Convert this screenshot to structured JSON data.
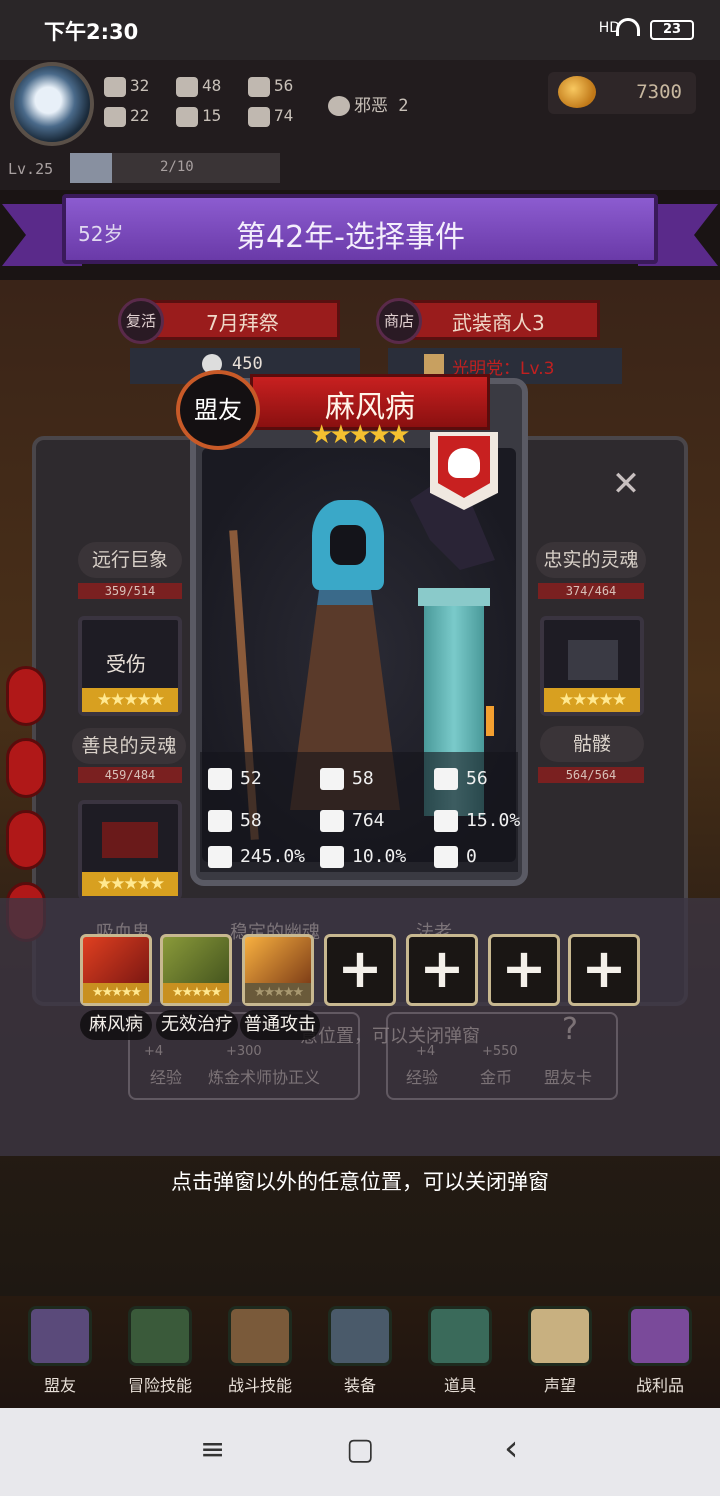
{
  "status_bar": {
    "time": "下午2:30",
    "signal": "HD",
    "battery": "23"
  },
  "player": {
    "stats": [
      {
        "icon": "fist-icon",
        "value": "32"
      },
      {
        "icon": "clover-icon",
        "value": "22"
      },
      {
        "icon": "boot-icon",
        "value": "48"
      },
      {
        "icon": "armor-icon",
        "value": "15"
      },
      {
        "icon": "wizard-hat-icon",
        "value": "56"
      },
      {
        "icon": "leaf-icon",
        "value": "74"
      }
    ],
    "alignment": "邪恶 2",
    "coins": "7300",
    "level": "Lv.25",
    "xp_text": "2/10",
    "xp_progress": 0.2
  },
  "banner": {
    "age": "52岁",
    "title": "第42年-选择事件"
  },
  "events": [
    {
      "tag": "复活",
      "name": "7月拜祭",
      "cost": "450"
    },
    {
      "tag": "商店",
      "name": "武装商人3",
      "extra": "光明党：Lv.3"
    }
  ],
  "side_left": [
    {
      "name": "远行巨象",
      "hp": "359/514"
    },
    {
      "name": "善良的灵魂",
      "hp": "459/484",
      "card_label": "受伤"
    },
    {
      "name": "吸血鬼"
    }
  ],
  "side_right": [
    {
      "name": "忠实的灵魂",
      "hp": "374/464"
    },
    {
      "name": "骷髅",
      "hp": "564/564"
    },
    {
      "name": "法老"
    }
  ],
  "middle_ghost": "稳定的幽魂",
  "card": {
    "badge": "盟友",
    "name": "麻风病",
    "stars": "★★★★★",
    "stats": [
      {
        "icon": "sword-icon",
        "value": "52"
      },
      {
        "icon": "shield-icon",
        "value": "58"
      },
      {
        "icon": "hook-icon",
        "value": "56"
      },
      {
        "icon": "hood-icon",
        "value": "58"
      },
      {
        "icon": "heart-icon",
        "value": "764"
      },
      {
        "icon": "flame-icon",
        "value": "15.0%"
      },
      {
        "icon": "burst-icon",
        "value": "245.0%"
      },
      {
        "icon": "tornado-icon",
        "value": "10.0%"
      },
      {
        "icon": "boot-icon",
        "value": "0"
      }
    ]
  },
  "skills": [
    {
      "name": "麻风病",
      "stars": "★★★★★",
      "color": "#c83020"
    },
    {
      "name": "无效治疗",
      "stars": "★★★★★",
      "color": "#6a7a2a"
    },
    {
      "name": "普通攻击",
      "stars": "★★★★★",
      "color": "#c87020"
    }
  ],
  "add_slot": "+",
  "rewards_ghost": [
    {
      "amount": "+4",
      "label": "经验"
    },
    {
      "amount": "+300",
      "label": "炼金术师协正义"
    },
    {
      "amount": "+4",
      "label": "经验"
    },
    {
      "amount": "+550",
      "label": "金币"
    },
    {
      "amount": "?",
      "label": "盟友卡"
    }
  ],
  "ghost_hint": "意位置，可以关闭弹窗",
  "hint": "点击弹窗以外的任意位置，可以关闭弹窗",
  "nav": [
    {
      "label": "盟友",
      "icon": "gloves-icon"
    },
    {
      "label": "冒险技能",
      "icon": "spellbook-icon"
    },
    {
      "label": "战斗技能",
      "icon": "backpack-icon"
    },
    {
      "label": "装备",
      "icon": "crossed-swords-icon"
    },
    {
      "label": "道具",
      "icon": "satchel-icon"
    },
    {
      "label": "声望",
      "icon": "scroll-icon"
    },
    {
      "label": "战利品",
      "icon": "treasure-chest-icon"
    }
  ],
  "close": "✕",
  "system": {
    "menu": "≡",
    "home": "▢",
    "back": "‹"
  }
}
